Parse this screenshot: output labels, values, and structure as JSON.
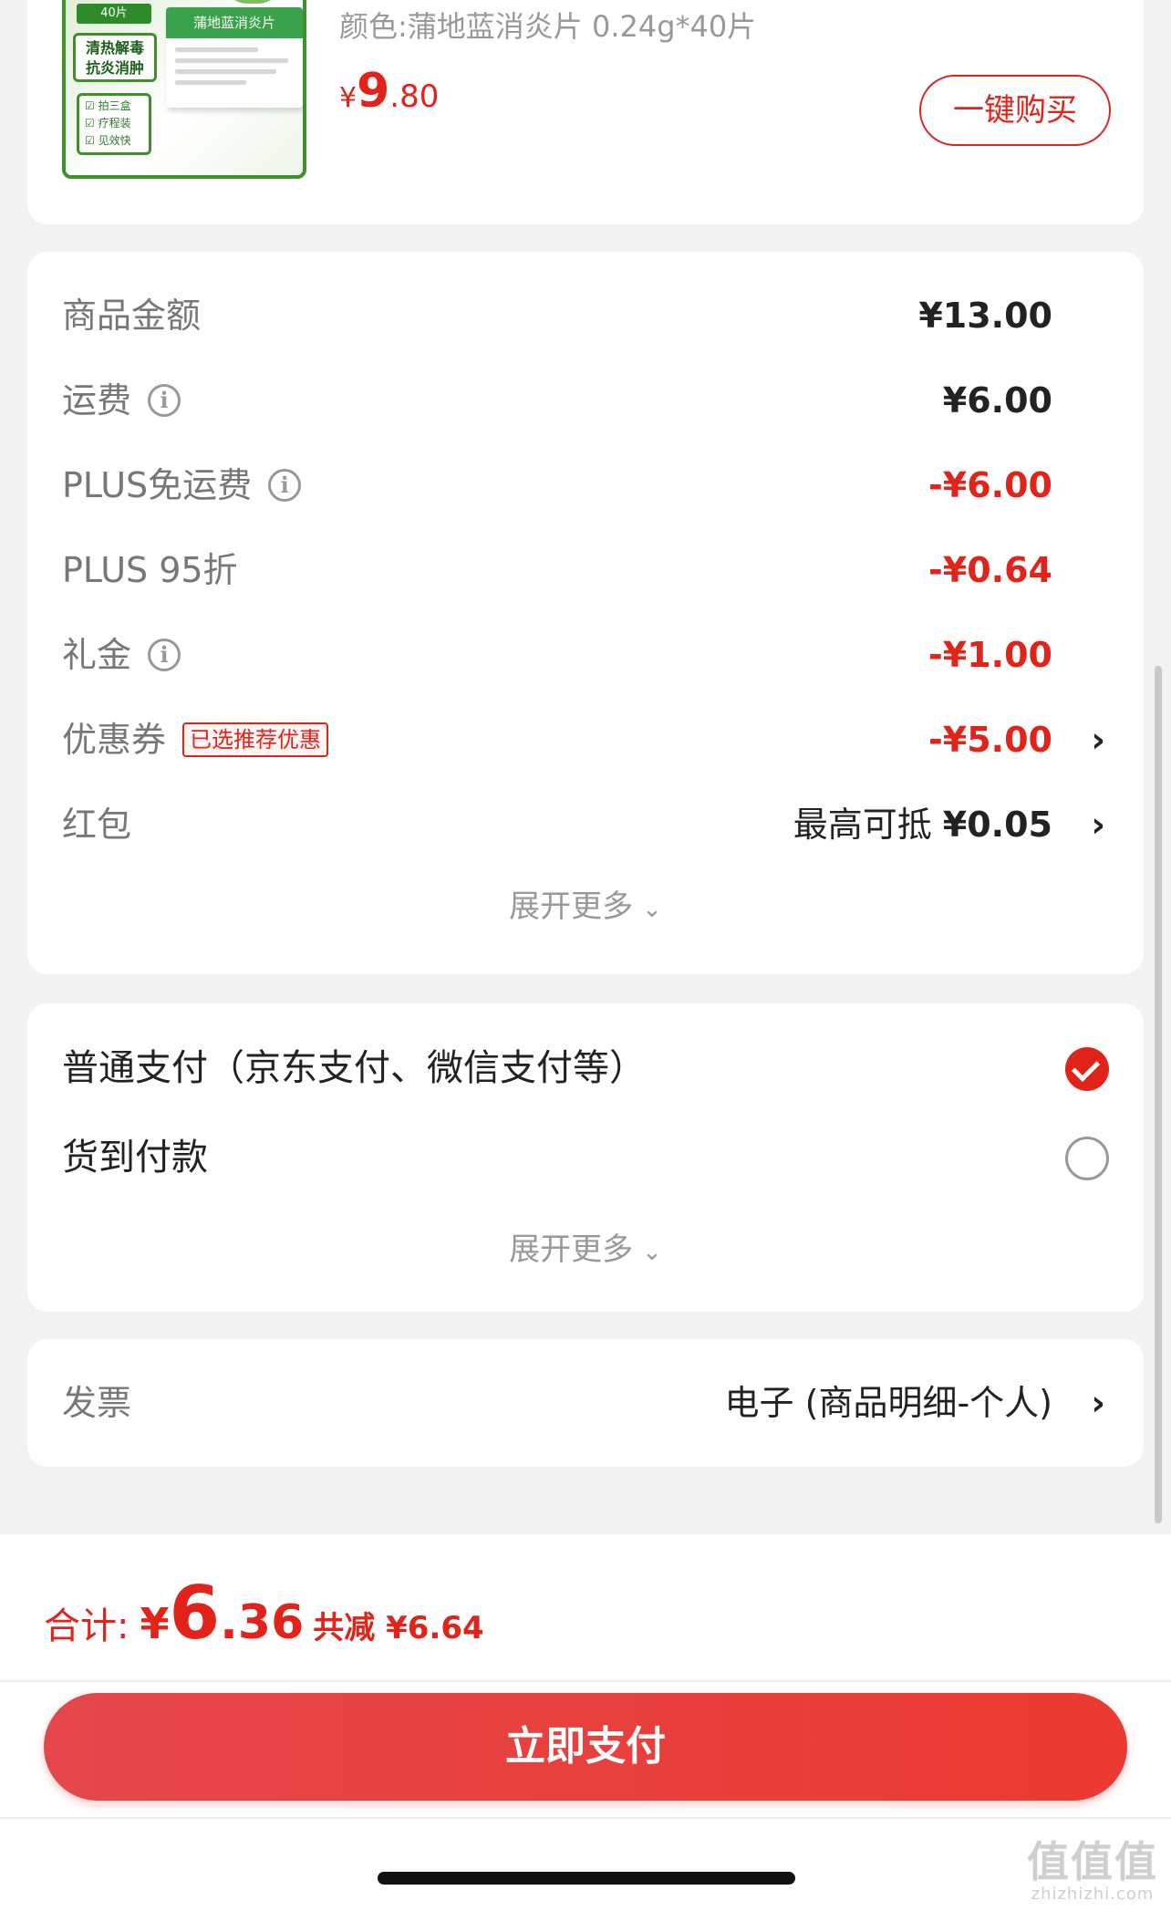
{
  "product": {
    "thumb": {
      "top_tag": "40片",
      "slogan_line1": "清热解毒",
      "slogan_line2": "抗炎消肿",
      "features": [
        "拍三盒",
        "疗程装",
        "见效快"
      ],
      "box_title": "蒲地蓝消炎片"
    },
    "spec": "颜色:蒲地蓝消炎片 0.24g*40片",
    "price": {
      "currency": "¥",
      "int": "9",
      "dec": ".80"
    },
    "buy_label": "一键购买"
  },
  "summary": {
    "rows": [
      {
        "label": "商品金额",
        "value": "¥13.00"
      },
      {
        "label": "运费",
        "value": "¥6.00"
      },
      {
        "label": "PLUS免运费",
        "value": "-¥6.00"
      },
      {
        "label": "PLUS 95折",
        "value": "-¥0.64"
      },
      {
        "label": "礼金",
        "value": "-¥1.00"
      },
      {
        "label": "优惠券",
        "badge": "已选推荐优惠",
        "value": "-¥5.00"
      },
      {
        "label": "红包",
        "value_prefix": "最高可抵",
        "value": "¥0.05"
      }
    ],
    "expand_label": "展开更多"
  },
  "payment": {
    "options": [
      {
        "label": "普通支付（京东支付、微信支付等）",
        "selected": true
      },
      {
        "label": "货到付款",
        "selected": false
      }
    ],
    "expand_label": "展开更多"
  },
  "invoice": {
    "label": "发票",
    "value": "电子 (商品明细-个人)"
  },
  "footer": {
    "total_label": "合计:",
    "total_currency": "¥",
    "total_int": "6",
    "total_dec": ".36",
    "savings": "共减 ¥6.64",
    "pay_button": "立即支付"
  },
  "watermark": {
    "big": "值值值",
    "small": "zhizhizhi.com"
  },
  "colors": {
    "accent": "#e2231a",
    "background": "#f2f2f2"
  }
}
